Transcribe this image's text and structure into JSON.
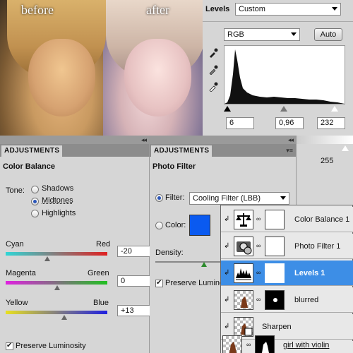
{
  "photo": {
    "before_label": "before",
    "after_label": "after"
  },
  "levels": {
    "title": "Levels",
    "preset": "Custom",
    "channel": "RGB",
    "auto_label": "Auto",
    "input_black": "6",
    "input_gamma": "0,96",
    "input_white": "232",
    "output_white": "255"
  },
  "color_balance": {
    "tab_label": "ADJUSTMENTS",
    "title": "Color Balance",
    "tone_label": "Tone:",
    "tones": [
      "Shadows",
      "Midtones",
      "Highlights"
    ],
    "selected_tone": "Midtones",
    "sliders": [
      {
        "left": "Cyan",
        "right": "Red",
        "value": "-20",
        "from": "#2fd6d6",
        "to": "#e02020"
      },
      {
        "left": "Magenta",
        "right": "Green",
        "value": "0",
        "from": "#e020e0",
        "to": "#20c020"
      },
      {
        "left": "Yellow",
        "right": "Blue",
        "value": "+13",
        "from": "#e8e020",
        "to": "#2020e0"
      }
    ],
    "preserve_label": "Preserve Luminosity",
    "preserve_checked": true
  },
  "photo_filter": {
    "tab_label": "ADJUSTMENTS",
    "title": "Photo Filter",
    "filter_label": "Filter:",
    "filter_value": "Cooling Filter (LBB)",
    "color_label": "Color:",
    "swatch_color": "#0a5af0",
    "density_label": "Density:",
    "preserve_label": "Preserve Luminos"
  },
  "layers": {
    "rows": [
      {
        "name": "Color Balance 1",
        "icon": "color-balance-icon",
        "selected": false
      },
      {
        "name": "Photo Filter 1",
        "icon": "photo-filter-icon",
        "selected": false
      },
      {
        "name": "Levels 1",
        "icon": "levels-icon",
        "selected": true
      },
      {
        "name": "blurred",
        "icon": "image-thumb",
        "selected": false
      },
      {
        "name": "Sharpen",
        "icon": "smart-filter-icon",
        "selected": false
      },
      {
        "name": "girl with violin",
        "icon": "image-thumb",
        "selected": false
      }
    ]
  }
}
